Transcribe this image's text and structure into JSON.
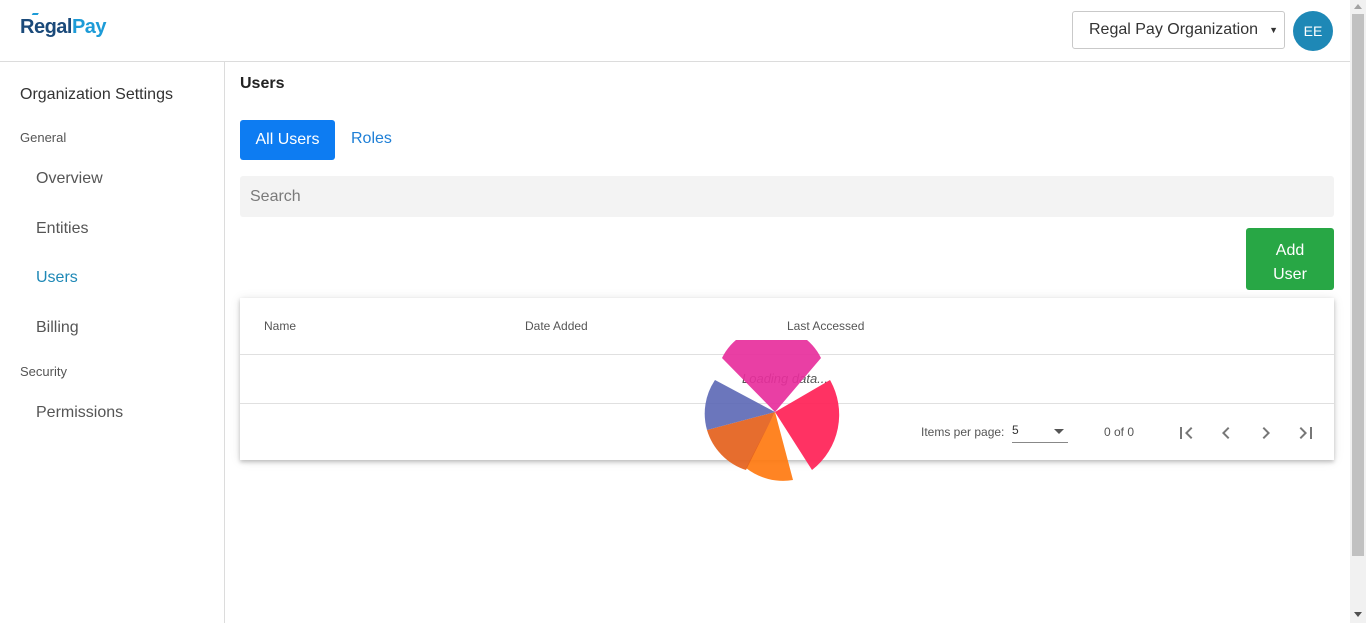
{
  "header": {
    "logo_regal": "Regal",
    "logo_pay": "Pay",
    "org_select": "Regal Pay Organization",
    "avatar": "EE"
  },
  "sidebar": {
    "title": "Organization Settings",
    "sections": [
      {
        "label": "General",
        "items": [
          "Overview",
          "Entities",
          "Users",
          "Billing"
        ]
      },
      {
        "label": "Security",
        "items": [
          "Permissions"
        ]
      }
    ],
    "active_item": "Users"
  },
  "main": {
    "title": "Users",
    "tabs": [
      {
        "label": "All Users",
        "active": true
      },
      {
        "label": "Roles",
        "active": false
      }
    ],
    "search": {
      "placeholder": "Search",
      "value": ""
    },
    "add_user_label": "Add User",
    "table": {
      "columns": [
        "Name",
        "Date Added",
        "Last Accessed"
      ],
      "loading_text": "Loading data..."
    },
    "paginator": {
      "items_per_page_label": "Items per page:",
      "items_per_page": "5",
      "range": "0 of 0"
    }
  },
  "colors": {
    "primary": "#0d7cf2",
    "accent": "#1e88b6",
    "success": "#28a745"
  }
}
